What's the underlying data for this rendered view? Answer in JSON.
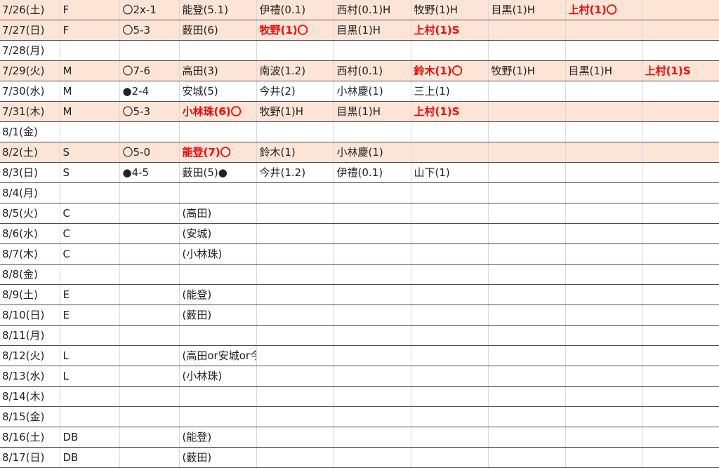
{
  "colors": {
    "win_row_bg": "#fce4d6",
    "highlight_text": "#ff0000"
  },
  "rows": [
    {
      "win": true,
      "cells": [
        "7/26(土)",
        "F",
        "〇2x-1",
        "能登(5.1)",
        "伊禮(0.1)",
        "西村(0.1)H",
        "牧野(1)H",
        "目黒(1)H",
        "上村(1)〇",
        ""
      ],
      "hl": [
        8
      ]
    },
    {
      "win": true,
      "cells": [
        "7/27(日)",
        "F",
        "〇5-3",
        "薮田(6)",
        "牧野(1)〇",
        "目黒(1)H",
        "上村(1)S",
        "",
        "",
        ""
      ],
      "hl": [
        4,
        6
      ]
    },
    {
      "win": false,
      "cells": [
        "7/28(月)",
        "",
        "",
        "",
        "",
        "",
        "",
        "",
        "",
        ""
      ],
      "hl": []
    },
    {
      "win": true,
      "cells": [
        "7/29(火)",
        "M",
        "〇7-6",
        "高田(3)",
        "南波(1.2)",
        "西村(0.1)",
        "鈴木(1)〇",
        "牧野(1)H",
        "目黒(1)H",
        "上村(1)S"
      ],
      "hl": [
        6,
        9
      ]
    },
    {
      "win": false,
      "cells": [
        "7/30(水)",
        "M",
        "●2-4",
        "安城(5)",
        "今井(2)",
        "小林慶(1)",
        "三上(1)",
        "",
        "",
        ""
      ],
      "hl": []
    },
    {
      "win": true,
      "cells": [
        "7/31(木)",
        "M",
        "〇5-3",
        "小林珠(6)〇",
        "牧野(1)H",
        "目黒(1)H",
        "上村(1)S",
        "",
        "",
        ""
      ],
      "hl": [
        3,
        6
      ]
    },
    {
      "win": false,
      "cells": [
        "8/1(金)",
        "",
        "",
        "",
        "",
        "",
        "",
        "",
        "",
        ""
      ],
      "hl": []
    },
    {
      "win": true,
      "cells": [
        "8/2(土)",
        "S",
        "〇5-0",
        "能登(7)〇",
        "鈴木(1)",
        "小林慶(1)",
        "",
        "",
        "",
        ""
      ],
      "hl": [
        3
      ]
    },
    {
      "win": false,
      "cells": [
        "8/3(日)",
        "S",
        "●4-5",
        "薮田(5)●",
        "今井(1.2)",
        "伊禮(0.1)",
        "山下(1)",
        "",
        "",
        ""
      ],
      "hl": []
    },
    {
      "win": false,
      "cells": [
        "8/4(月)",
        "",
        "",
        "",
        "",
        "",
        "",
        "",
        "",
        ""
      ],
      "hl": []
    },
    {
      "win": false,
      "cells": [
        "8/5(火)",
        "C",
        "",
        "(高田)",
        "",
        "",
        "",
        "",
        "",
        ""
      ],
      "hl": []
    },
    {
      "win": false,
      "cells": [
        "8/6(水)",
        "C",
        "",
        "(安城)",
        "",
        "",
        "",
        "",
        "",
        ""
      ],
      "hl": []
    },
    {
      "win": false,
      "cells": [
        "8/7(木)",
        "C",
        "",
        "(小林珠)",
        "",
        "",
        "",
        "",
        "",
        ""
      ],
      "hl": []
    },
    {
      "win": false,
      "cells": [
        "8/8(金)",
        "",
        "",
        "",
        "",
        "",
        "",
        "",
        "",
        ""
      ],
      "hl": []
    },
    {
      "win": false,
      "cells": [
        "8/9(土)",
        "E",
        "",
        "(能登)",
        "",
        "",
        "",
        "",
        "",
        ""
      ],
      "hl": []
    },
    {
      "win": false,
      "cells": [
        "8/10(日)",
        "E",
        "",
        "(薮田)",
        "",
        "",
        "",
        "",
        "",
        ""
      ],
      "hl": []
    },
    {
      "win": false,
      "cells": [
        "8/11(月)",
        "",
        "",
        "",
        "",
        "",
        "",
        "",
        "",
        ""
      ],
      "hl": []
    },
    {
      "win": false,
      "cells": [
        "8/12(火)",
        "L",
        "",
        "(高田or安城or今井)",
        "",
        "",
        "",
        "",
        "",
        ""
      ],
      "hl": []
    },
    {
      "win": false,
      "cells": [
        "8/13(水)",
        "L",
        "",
        "(小林珠)",
        "",
        "",
        "",
        "",
        "",
        ""
      ],
      "hl": []
    },
    {
      "win": false,
      "cells": [
        "8/14(木)",
        "",
        "",
        "",
        "",
        "",
        "",
        "",
        "",
        ""
      ],
      "hl": []
    },
    {
      "win": false,
      "cells": [
        "8/15(金)",
        "",
        "",
        "",
        "",
        "",
        "",
        "",
        "",
        ""
      ],
      "hl": []
    },
    {
      "win": false,
      "cells": [
        "8/16(土)",
        "DB",
        "",
        "(能登)",
        "",
        "",
        "",
        "",
        "",
        ""
      ],
      "hl": []
    },
    {
      "win": false,
      "cells": [
        "8/17(日)",
        "DB",
        "",
        "(薮田)",
        "",
        "",
        "",
        "",
        "",
        ""
      ],
      "hl": []
    }
  ]
}
